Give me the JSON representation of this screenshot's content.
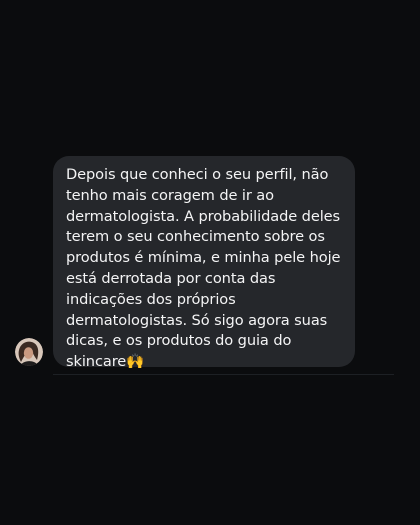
{
  "message": {
    "text": "Depois que conheci o seu perfil, não\ntenho mais coragem de ir ao\ndermatologista. A probabilidade deles\nterem o seu conhecimento sobre os\nprodutos é mínima, e minha pele hoje\nestá derrotada por conta das\nindicações dos próprios\ndermatologistas. Só sigo agora suas\ndicas, e os produtos do guia do\nskincare🙌"
  },
  "sender": {
    "avatar": "profile-photo-avatar"
  }
}
